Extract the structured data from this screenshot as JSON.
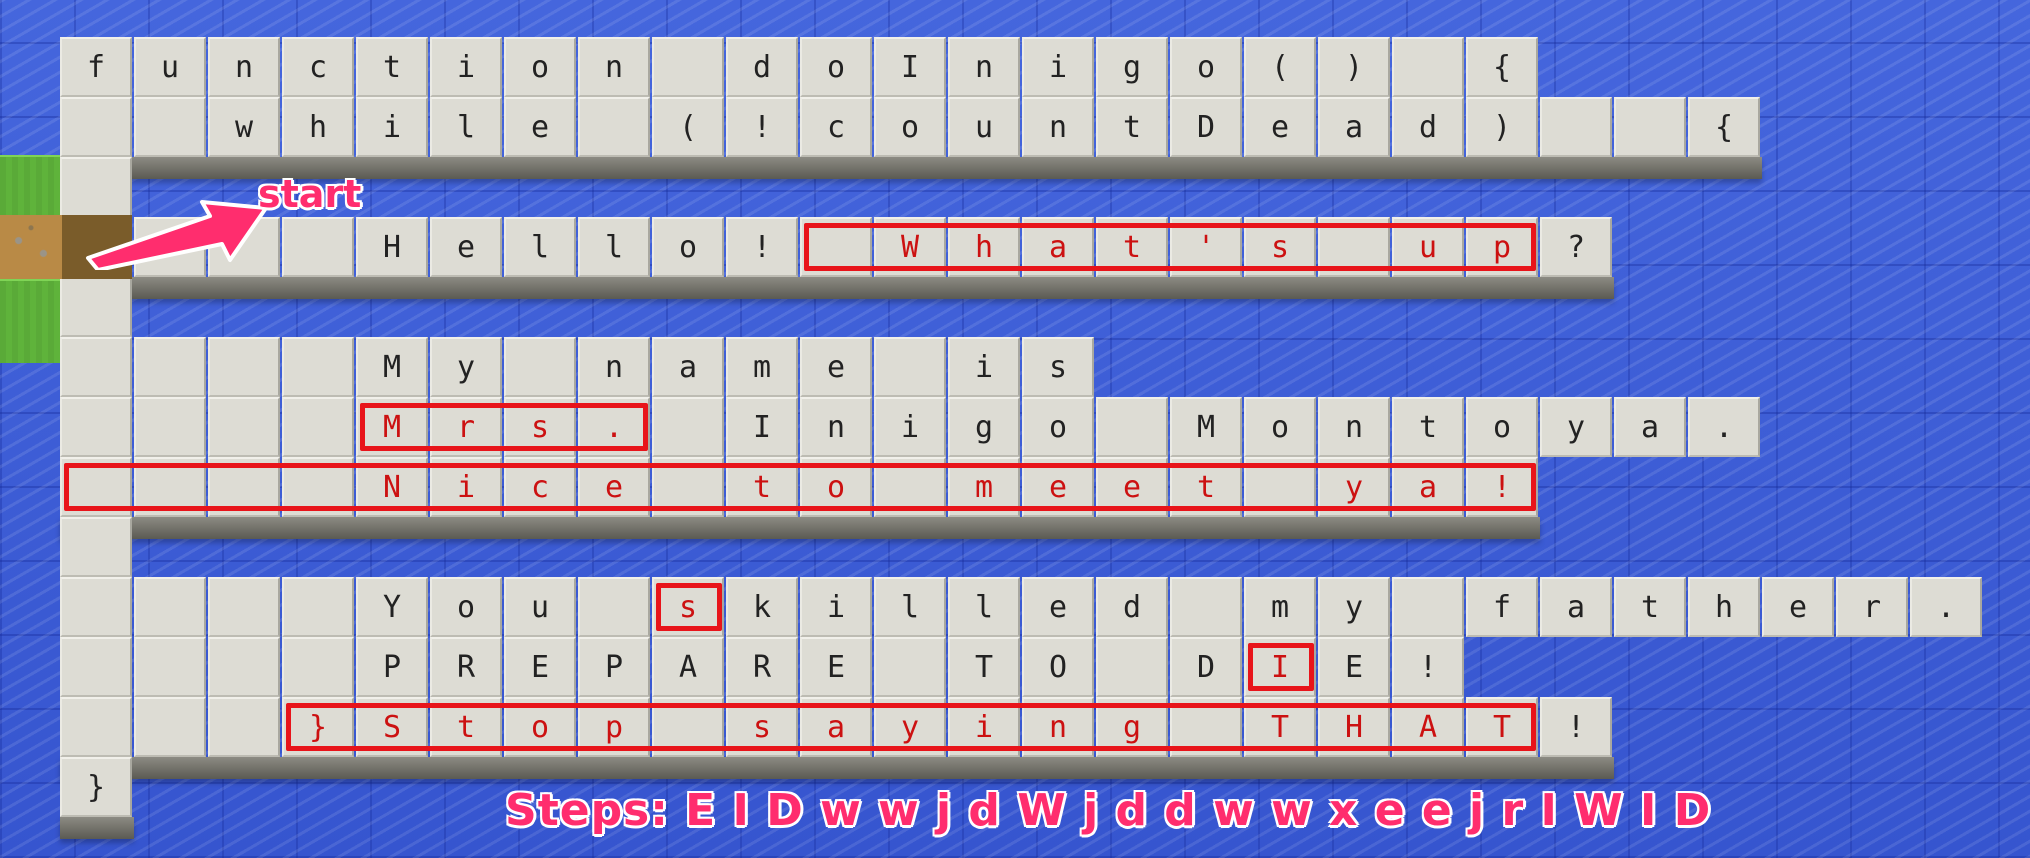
{
  "level": {
    "rows": [
      {
        "start": 0,
        "text": "function doInigo() {"
      },
      {
        "start": 0,
        "text": "  while (!countDead)  {"
      },
      {
        "start": 0,
        "text": " "
      },
      {
        "start": 0,
        "text": "    Hello! What's up?"
      },
      {
        "start": 0,
        "text": " "
      },
      {
        "start": 0,
        "text": "    My name is"
      },
      {
        "start": 0,
        "text": "    Mrs. Inigo Montoya."
      },
      {
        "start": 0,
        "text": "    Nice to meet ya!"
      },
      {
        "start": 0,
        "text": " "
      },
      {
        "start": 0,
        "text": "    You skilled my father."
      },
      {
        "start": 0,
        "text": "    PREPARE TO DIE!"
      },
      {
        "start": 0,
        "text": "   }Stop saying THAT!"
      },
      {
        "start": 0,
        "text": "}"
      }
    ],
    "red_ranges": [
      {
        "row": 3,
        "from": 10,
        "to": 20
      },
      {
        "row": 6,
        "from": 4,
        "to": 8
      },
      {
        "row": 7,
        "from": 0,
        "to": 20
      },
      {
        "row": 9,
        "from": 8,
        "to": 9
      },
      {
        "row": 10,
        "from": 16,
        "to": 17
      },
      {
        "row": 11,
        "from": 3,
        "to": 20
      }
    ],
    "shelf_rows": [
      1,
      3,
      7,
      11,
      12
    ]
  },
  "labels": {
    "start": "start",
    "steps": "Steps: E I D w w j d W j d d w w x e e j r I W I D"
  },
  "colors": {
    "tile": "#dddcd4",
    "text": "#222222",
    "highlight": "#e8141a",
    "annotation": "#ff2d6e",
    "water": "#3d5dd6"
  }
}
